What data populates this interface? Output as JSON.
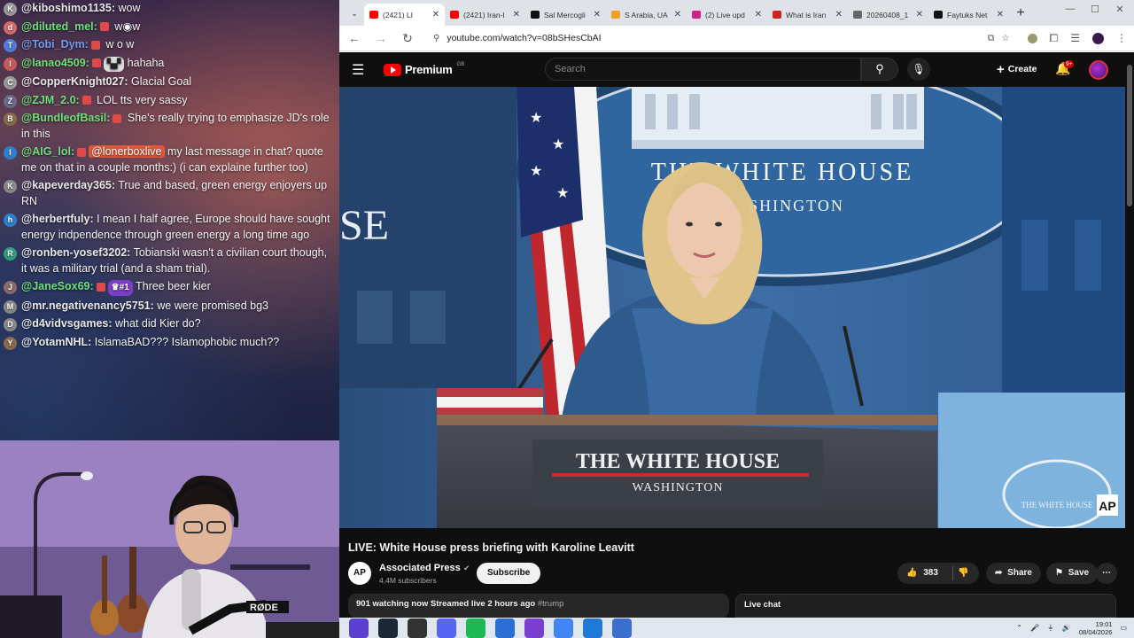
{
  "chat": {
    "messages": [
      {
        "avatar": "K",
        "avatar_color": "#9a9a9a",
        "user": "@kiboshimo1135:",
        "user_color": "#e8e8e8",
        "badge": false,
        "mention": "",
        "emote": "",
        "text": " wow"
      },
      {
        "avatar": "d",
        "avatar_color": "#d46a6a",
        "user": "@diluted_mel:",
        "user_color": "#6ee07a",
        "badge": true,
        "mention": "",
        "emote": "",
        "text": " w◉w"
      },
      {
        "avatar": "T",
        "avatar_color": "#4f7bd6",
        "user": "@Tobi_Dym:",
        "user_color": "#6f9cf0",
        "badge": true,
        "mention": "",
        "emote": "",
        "text": " w o w"
      },
      {
        "avatar": "l",
        "avatar_color": "#c95a5a",
        "user": "@lanao4509:",
        "user_color": "#6ee07a",
        "badge": true,
        "mention": "",
        "emote": "▚▞",
        "text": " hahaha"
      },
      {
        "avatar": "C",
        "avatar_color": "#9a9a9a",
        "user": "@CopperKnight027:",
        "user_color": "#e8e8e8",
        "badge": false,
        "mention": "",
        "emote": "",
        "text": " Glacial Goal"
      },
      {
        "avatar": "Z",
        "avatar_color": "#6a6a8a",
        "user": "@ZJM_2.0:",
        "user_color": "#6ee07a",
        "badge": true,
        "mention": "",
        "emote": "",
        "text": " LOL tts very sassy"
      },
      {
        "avatar": "B",
        "avatar_color": "#8a6a4a",
        "user": "@BundleofBasil:",
        "user_color": "#6ee07a",
        "badge": true,
        "mention": "",
        "emote": "",
        "text": " She's really trying to emphasize JD's role in this"
      },
      {
        "avatar": "I",
        "avatar_color": "#2f7fd0",
        "user": "@AIG_lol:",
        "user_color": "#6ee07a",
        "badge": true,
        "mention": "@lonerboxlive",
        "emote": "",
        "text": " my last message in chat? quote me on that in a couple months:) (i can explaine further too)"
      },
      {
        "avatar": "K",
        "avatar_color": "#8a8a8a",
        "user": "@kapeverday365:",
        "user_color": "#e8e8e8",
        "badge": false,
        "mention": "",
        "emote": "",
        "text": " True and based, green energy enjoyers up RN"
      },
      {
        "avatar": "h",
        "avatar_color": "#2f7fd0",
        "user": "@herbertfuly:",
        "user_color": "#e8e8e8",
        "badge": false,
        "mention": "",
        "emote": "",
        "text": " I mean I half agree, Europe should have sought energy indpendence through green energy a long time ago"
      },
      {
        "avatar": "R",
        "avatar_color": "#2fa07f",
        "user": "@ronben-yosef3202:",
        "user_color": "#e8e8e8",
        "badge": false,
        "mention": "",
        "emote": "",
        "text": " Tobianski wasn't a civilian court though, it was a military trial (and a sham trial)."
      },
      {
        "avatar": "J",
        "avatar_color": "#8a6a6a",
        "user": "@JaneSox69:",
        "user_color": "#6ee07a",
        "badge": true,
        "mention": "",
        "emote": "♛#1",
        "text": " Three beer kier"
      },
      {
        "avatar": "M",
        "avatar_color": "#8a8a8a",
        "user": "@mr.negativenancy5751:",
        "user_color": "#e8e8e8",
        "badge": false,
        "mention": "",
        "emote": "",
        "text": " we were promised bg3"
      },
      {
        "avatar": "D",
        "avatar_color": "#8a8a8a",
        "user": "@d4vidvsgames:",
        "user_color": "#e8e8e8",
        "badge": false,
        "mention": "",
        "emote": "",
        "text": " what did Kier do?"
      },
      {
        "avatar": "Y",
        "avatar_color": "#8a6a4a",
        "user": "@YotamNHL:",
        "user_color": "#e8e8e8",
        "badge": false,
        "mention": "",
        "emote": "",
        "text": " IslamaBAD??? Islamophobic much??"
      }
    ]
  },
  "webcam": {
    "mic_label": "RØDE"
  },
  "browser": {
    "tabs": [
      {
        "title": "(2421) LI",
        "color": "#ff0000",
        "active": true
      },
      {
        "title": "(2421) Iran-I",
        "color": "#ff0000",
        "active": false
      },
      {
        "title": "Sal Mercogli",
        "color": "#111111",
        "active": false
      },
      {
        "title": "S Arabia, UA",
        "color": "#f0a020",
        "active": false
      },
      {
        "title": "(2) Live upd",
        "color": "#cc2288",
        "active": false
      },
      {
        "title": "What is Iran",
        "color": "#c22",
        "active": false
      },
      {
        "title": "20260408_1",
        "color": "#666666",
        "active": false
      },
      {
        "title": "Faytuks Net",
        "color": "#111111",
        "active": false
      }
    ],
    "url": "youtube.com/watch?v=08bSHesCbAI"
  },
  "youtube": {
    "logo_text": "Premium",
    "country": "GB",
    "search_placeholder": "Search",
    "create_label": "Create",
    "bell_badge": "9+",
    "video_title": "LIVE: White House press briefing with Karoline Leavitt",
    "channel_name": "Associated Press",
    "channel_subs": "4.4M subscribers",
    "channel_avatar": "AP",
    "subscribe_label": "Subscribe",
    "like_count": "383",
    "share_label": "Share",
    "save_label": "Save",
    "description_line": "901 watching now  Streamed live 2 hours ago",
    "description_tag": "#trump",
    "live_chat_label": "Live chat"
  },
  "video": {
    "backdrop_sign_letters": "SE",
    "seal_text_1": "THE WHITE HOUSE",
    "seal_text_2": "WASHINGTON",
    "podium_text_1": "THE WHITE HOUSE",
    "podium_text_2": "WASHINGTON",
    "corner_seal_text": "THE WHITE HOUSE",
    "watermark": "AP"
  },
  "taskbar": {
    "apps": [
      {
        "icon": "arc-icon",
        "color": "#5b3fd1"
      },
      {
        "icon": "steam-icon",
        "color": "#1b2838"
      },
      {
        "icon": "obs-icon",
        "color": "#333333"
      },
      {
        "icon": "discord-icon",
        "color": "#5865f2"
      },
      {
        "icon": "spotify-icon",
        "color": "#1db954"
      },
      {
        "icon": "app-blue-icon",
        "color": "#2b6fd6"
      },
      {
        "icon": "app-purple-icon",
        "color": "#7a3fd1"
      },
      {
        "icon": "chrome-icon",
        "color": "#4285f4"
      },
      {
        "icon": "app-blue2-icon",
        "color": "#1e7ad6"
      },
      {
        "icon": "calculator-icon",
        "color": "#3a6fd0"
      }
    ],
    "time": "19:01",
    "date": "08/04/2026"
  }
}
